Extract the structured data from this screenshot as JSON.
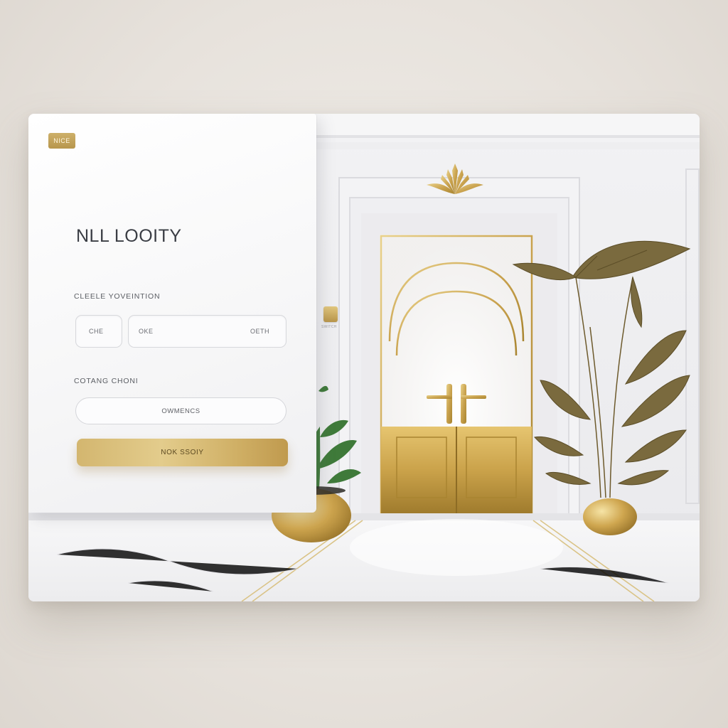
{
  "panel": {
    "badge": "NICE",
    "title": "NLL LOOITY",
    "section1_label": "CLEELE YOVEINTION",
    "field_short": "CHE",
    "field_long_left": "OKE",
    "field_long_right": "OETH",
    "section2_label": "COTANG CHONI",
    "pill_text": "OWMENCS",
    "cta_label": "NOK SSOIY"
  },
  "scene": {
    "switch_label": "SWITCH"
  },
  "colors": {
    "gold": "#c9a95e",
    "panel_bg": "#f8f8f9",
    "text_dark": "#3a3d44"
  }
}
